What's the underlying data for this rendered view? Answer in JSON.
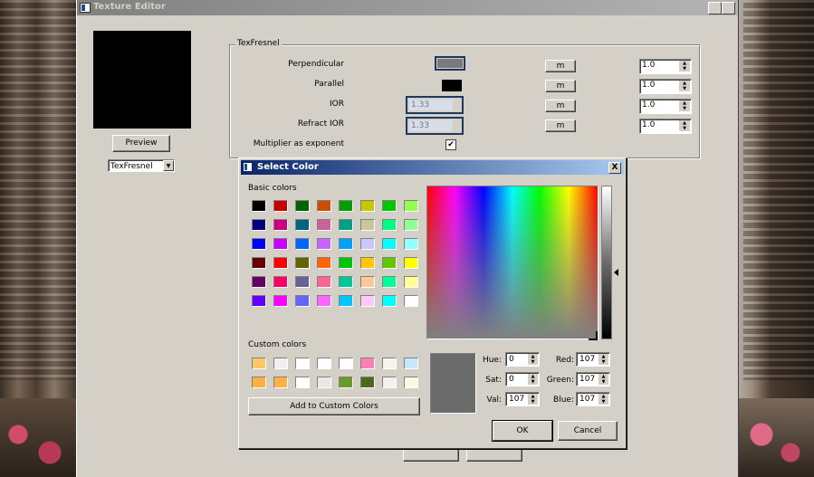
{
  "window": {
    "title": "Texture Editor",
    "help_label": "?",
    "close_label": "X"
  },
  "preview": {
    "button_label": "Preview",
    "combo_value": "TexFresnel"
  },
  "group": {
    "title": "TexFresnel",
    "rows": [
      {
        "label": "Perpendicular",
        "m": "m",
        "value": "1.0"
      },
      {
        "label": "Parallel",
        "m": "m",
        "value": "1.0"
      },
      {
        "label": "IOR",
        "ior": "1.33",
        "m": "m",
        "value": "1.0"
      },
      {
        "label": "Refract IOR",
        "ior": "1.33",
        "m": "m",
        "value": "1.0"
      }
    ],
    "multiplier_label": "Multiplier as exponent",
    "multiplier_checked": true,
    "check_mark": "✔"
  },
  "dialog": {
    "title": "Select Color",
    "close_label": "X",
    "basic_label": "Basic colors",
    "custom_label": "Custom colors",
    "add_button": "Add to Custom Colors",
    "ok": "OK",
    "cancel": "Cancel",
    "fields": {
      "hue_label": "Hue:",
      "hue": "0",
      "sat_label": "Sat:",
      "sat": "0",
      "val_label": "Val:",
      "val": "107",
      "red_label": "Red:",
      "red": "107",
      "green_label": "Green:",
      "green": "107",
      "blue_label": "Blue:",
      "blue": "107"
    },
    "basic_colors": [
      "#000000",
      "#c80000",
      "#006400",
      "#c85000",
      "#00a000",
      "#c8c800",
      "#00c800",
      "#90ff50",
      "#000080",
      "#c80080",
      "#006480",
      "#c86496",
      "#00a080",
      "#c8c896",
      "#00ff80",
      "#90ff96",
      "#0000ff",
      "#c800ff",
      "#0064ff",
      "#c864ff",
      "#00a0ff",
      "#c8c8ff",
      "#00ffff",
      "#90ffff",
      "#640000",
      "#ff0000",
      "#646400",
      "#ff6400",
      "#00c800",
      "#ffc800",
      "#64c800",
      "#ffff00",
      "#640064",
      "#ff0064",
      "#646496",
      "#ff6496",
      "#00c896",
      "#ffc896",
      "#00ff96",
      "#ffff96",
      "#6400ff",
      "#ff00ff",
      "#6464ff",
      "#ff64ff",
      "#00c8ff",
      "#ffc8ff",
      "#00ffff",
      "#ffffff"
    ],
    "custom_colors": [
      "#ffc864",
      "#f0f0f0",
      "#ffffff",
      "#ffffff",
      "#ffffff",
      "#ff80b0",
      "#f4f4f0",
      "#c8e6ff",
      "#ffb040",
      "#ffb040",
      "#ffffff",
      "#e8e8e8",
      "#6a9a2a",
      "#4a6a1a",
      "#f0f0f0",
      "#fff8e0"
    ]
  }
}
